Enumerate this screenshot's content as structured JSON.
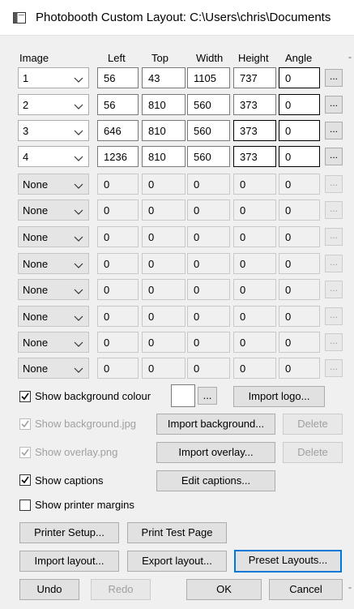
{
  "window": {
    "title": "Photobooth Custom Layout: C:\\Users\\chris\\Documents"
  },
  "headers": {
    "image": "Image",
    "left": "Left",
    "top": "Top",
    "width": "Width",
    "height": "Height",
    "angle": "Angle"
  },
  "rows": [
    {
      "image": "1",
      "left": "56",
      "top": "43",
      "width": "1105",
      "height": "737",
      "angle": "0",
      "enabled": true
    },
    {
      "image": "2",
      "left": "56",
      "top": "810",
      "width": "560",
      "height": "373",
      "angle": "0",
      "enabled": true
    },
    {
      "image": "3",
      "left": "646",
      "top": "810",
      "width": "560",
      "height": "373",
      "angle": "0",
      "enabled": true
    },
    {
      "image": "4",
      "left": "1236",
      "top": "810",
      "width": "560",
      "height": "373",
      "angle": "0",
      "enabled": true
    },
    {
      "image": "None",
      "left": "0",
      "top": "0",
      "width": "0",
      "height": "0",
      "angle": "0",
      "enabled": false
    },
    {
      "image": "None",
      "left": "0",
      "top": "0",
      "width": "0",
      "height": "0",
      "angle": "0",
      "enabled": false
    },
    {
      "image": "None",
      "left": "0",
      "top": "0",
      "width": "0",
      "height": "0",
      "angle": "0",
      "enabled": false
    },
    {
      "image": "None",
      "left": "0",
      "top": "0",
      "width": "0",
      "height": "0",
      "angle": "0",
      "enabled": false
    },
    {
      "image": "None",
      "left": "0",
      "top": "0",
      "width": "0",
      "height": "0",
      "angle": "0",
      "enabled": false
    },
    {
      "image": "None",
      "left": "0",
      "top": "0",
      "width": "0",
      "height": "0",
      "angle": "0",
      "enabled": false
    },
    {
      "image": "None",
      "left": "0",
      "top": "0",
      "width": "0",
      "height": "0",
      "angle": "0",
      "enabled": false
    },
    {
      "image": "None",
      "left": "0",
      "top": "0",
      "width": "0",
      "height": "0",
      "angle": "0",
      "enabled": false
    }
  ],
  "dots_label": "...",
  "options": {
    "bg_colour": {
      "label": "Show background colour",
      "checked": true,
      "enabled": true,
      "color": "#ffffff"
    },
    "bg_jpg": {
      "label": "Show background.jpg",
      "checked": true,
      "enabled": false
    },
    "overlay": {
      "label": "Show overlay.png",
      "checked": true,
      "enabled": false
    },
    "captions": {
      "label": "Show captions",
      "checked": true,
      "enabled": true
    },
    "printer_margins": {
      "label": "Show printer margins",
      "checked": false,
      "enabled": true
    }
  },
  "buttons": {
    "import_logo": "Import logo...",
    "import_background": "Import background...",
    "delete_bg": "Delete",
    "import_overlay": "Import overlay...",
    "delete_overlay": "Delete",
    "edit_captions": "Edit captions...",
    "printer_setup": "Printer Setup...",
    "print_test_page": "Print Test Page",
    "import_layout": "Import layout...",
    "export_layout": "Export layout...",
    "preset_layouts": "Preset Layouts...",
    "undo": "Undo",
    "redo": "Redo",
    "ok": "OK",
    "cancel": "Cancel"
  },
  "edge_marks": {
    "header": "-",
    "footer": "-"
  }
}
